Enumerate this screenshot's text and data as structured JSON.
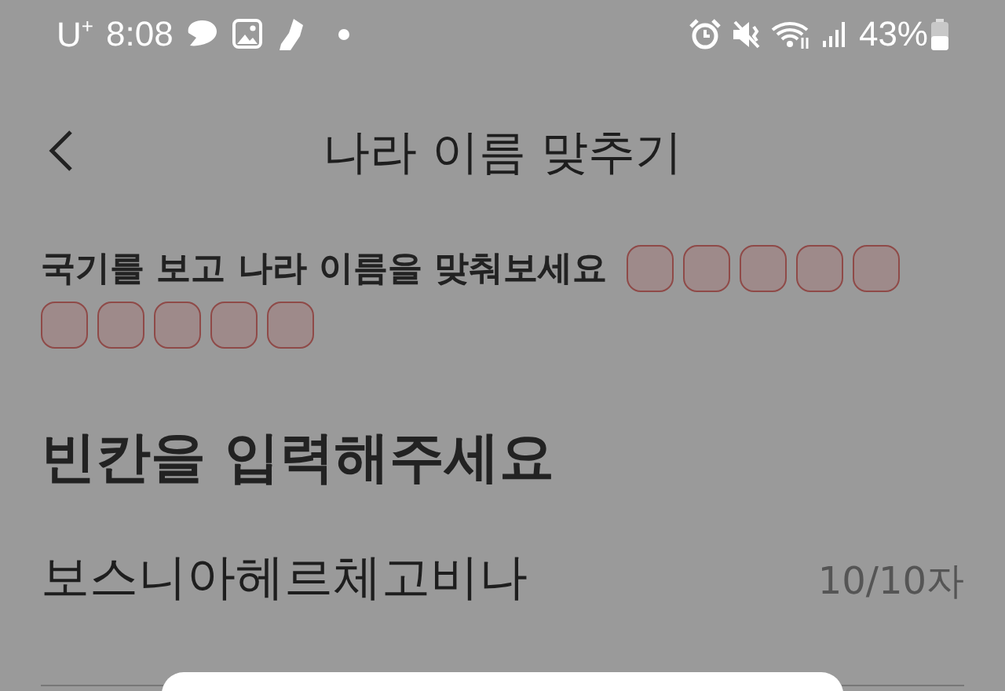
{
  "status_bar": {
    "carrier": "U$^{+}$",
    "time": "8:08",
    "battery": "43%"
  },
  "header": {
    "title": "나라 이름 맞추기"
  },
  "prompt": "국기를 보고  나라 이름을 맞춰보세요",
  "blanks": [
    {
      "filled": false
    },
    {
      "filled": false
    },
    {
      "filled": false
    },
    {
      "filled": false
    },
    {
      "filled": false
    },
    {
      "filled": false
    },
    {
      "filled": false
    },
    {
      "filled": false
    },
    {
      "filled": false
    },
    {
      "filled": false
    }
  ],
  "section_title": "빈칸을 입력해주세요",
  "answer": {
    "value": "보스니아헤르체고비나",
    "counter": "10/10자"
  },
  "bottom_sheet": {
    "open": true
  }
}
